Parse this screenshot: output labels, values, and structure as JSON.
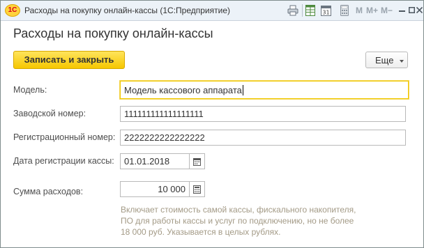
{
  "window": {
    "title": "Расходы на покупку онлайн-кассы  (1С:Предприятие)",
    "logo_text": "1С",
    "toolbar": {
      "m": "M",
      "m_plus": "M+",
      "m_minus": "M−"
    }
  },
  "form": {
    "title": "Расходы на покупку онлайн-кассы",
    "save_button": "Записать и закрыть",
    "more_button": "Еще",
    "fields": {
      "model": {
        "label": "Модель:",
        "value": "Модель кассового аппарата"
      },
      "serial": {
        "label": "Заводской номер:",
        "value": "111111111111111111"
      },
      "reg_number": {
        "label": "Регистрационный номер:",
        "value": "2222222222222222"
      },
      "reg_date": {
        "label": "Дата регистрации кассы:",
        "value": "01.01.2018"
      },
      "amount": {
        "label": "Сумма расходов:",
        "value": "10 000"
      }
    },
    "hint": {
      "line1": "Включает стоимость самой кассы, фискального накопителя,",
      "line2": "ПО для работы кассы и услуг по подключению, но не более",
      "line3": "18 000 руб. Указывается в целых рублях."
    }
  },
  "colors": {
    "accent_yellow": "#f6c700",
    "titlebar_bg": "#ecf2f8",
    "hint_text": "#a39a86",
    "logo_red": "#d9001b"
  },
  "icons": {
    "app": "1c-logo-icon",
    "print": "print-icon",
    "spreadsheet": "spreadsheet-icon",
    "calendar": "calendar-icon",
    "calculator": "calculator-icon",
    "minimize": "minimize-icon",
    "maximize": "maximize-icon",
    "close": "close-icon"
  }
}
